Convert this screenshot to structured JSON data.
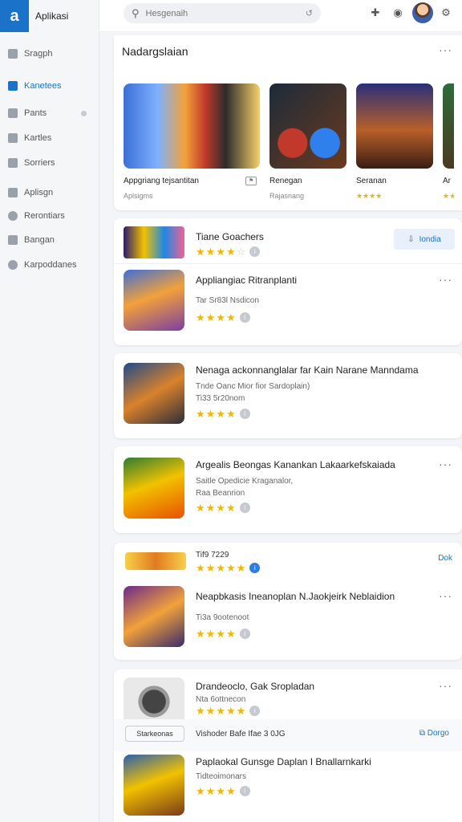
{
  "app": {
    "title": "Aplikasi",
    "logo": "a"
  },
  "sidebar": {
    "items": [
      {
        "label": "Sragph",
        "icon": "grid-icon",
        "active": false
      },
      {
        "label": "Kanetees",
        "icon": "bookmark-icon",
        "active": true
      },
      {
        "label": "Pants",
        "icon": "list-icon",
        "active": false
      },
      {
        "label": "Kartles",
        "icon": "window-icon",
        "active": false
      },
      {
        "label": "Sorriers",
        "icon": "folder-icon",
        "active": false
      },
      {
        "label": "Aplisgn",
        "icon": "shield-icon",
        "active": false
      },
      {
        "label": "Rerontiars",
        "icon": "clock-icon",
        "active": false
      },
      {
        "label": "Bangan",
        "icon": "box-icon",
        "active": false
      },
      {
        "label": "Karpoddanes",
        "icon": "gear-icon",
        "active": false
      }
    ]
  },
  "topbar": {
    "search_placeholder": "Hesgenaih",
    "icons": [
      "plus-icon",
      "shield-icon",
      "gear-icon"
    ]
  },
  "featured": {
    "title": "Nadargslaian",
    "items": [
      {
        "title": "Appgriang tejsantitan",
        "sub": "Aplsigms"
      },
      {
        "title": "Renegan",
        "sub": "Rajasnang"
      },
      {
        "title": "Seranan",
        "sub": "★★★★"
      },
      {
        "title": "Ar",
        "sub": "★★"
      }
    ]
  },
  "list": {
    "card1": {
      "top_title": "Tiane Goachers",
      "top_stars": "★★★★",
      "button": "Iondia",
      "app": {
        "name": "Appliangiac Ritranplanti",
        "sub": "Tar Sr83l Nsdicon",
        "stars": "★★★★"
      }
    },
    "card2": {
      "name": "Nenaga ackonnanglalar far Kain Narane Manndama",
      "sub1": "Tnde Oanc Mior fior Sardoplain)",
      "sub2": "Ti33 5r20nom",
      "stars": "★★★★"
    },
    "card3": {
      "name": "Argealis Beongas Kanankan Lakaarkefskaiada",
      "sub1": "Saitle Opedicie Kraganalor,",
      "sub2": "Raa Beanrion",
      "stars": "★★★★"
    },
    "card4": {
      "top_title": "Tif9 7229",
      "top_stars": "★★★★★",
      "link": "Dok",
      "app": {
        "name": "Neapbkasis Ineanoplan N.Jaokjeirk Neblaidion",
        "sub": "Ti3a 9ootenoot",
        "stars": "★★★★"
      }
    },
    "card5": {
      "name": "Drandeoclo, Gak Sropladan",
      "sub": "Nta 6ottnecon",
      "stars": "★★★★★",
      "strip_text": "Vishoder Bafe Ifae 3 0JG",
      "strip_logo": "Starkeonas",
      "strip_link": "Dorgo"
    },
    "card6": {
      "name": "Paplaokal Gunsge Daplan I Bnallarnkarki",
      "sub": "Tidteoimonars",
      "stars": "★★★★"
    }
  }
}
